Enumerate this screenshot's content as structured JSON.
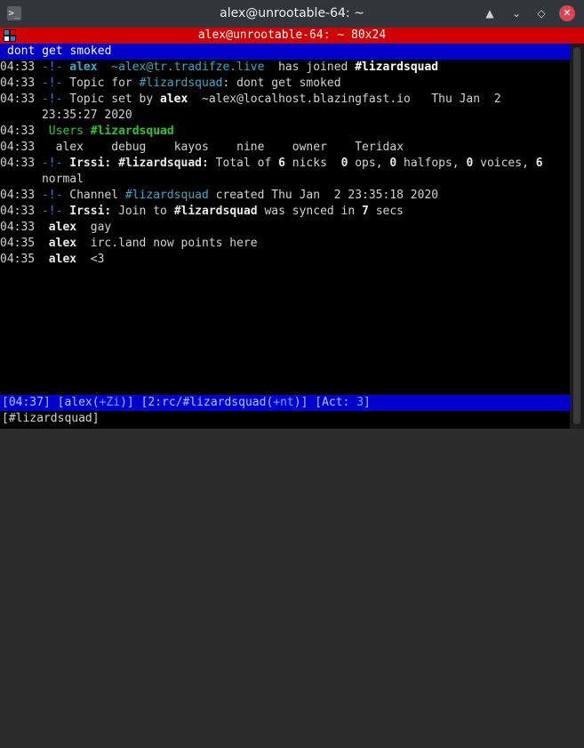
{
  "window": {
    "title": "alex@unrootable-64: ~",
    "tab_title": "alex@unrootable-64: ~ 80x24",
    "controls": {
      "shade": "▲",
      "minimize": "⌄",
      "maximize": "◇",
      "close": "✕"
    }
  },
  "topic_bar": "dont get smoked",
  "lines": [
    {
      "time": "04:33",
      "arrow": "-!-",
      "nick": "alex",
      "host": "~alex@tr.tradifze.live",
      "text": "has joined",
      "channel": "#lizardsquad"
    },
    {
      "time": "04:33",
      "arrow": "-!-",
      "pre": "Topic for",
      "channel": "#lizardsquad",
      "text": ": dont get smoked"
    },
    {
      "time": "04:33",
      "arrow": "-!-",
      "pre": "Topic set by",
      "nick": "alex",
      "host": "~alex@localhost.blazingfast.io",
      "text": "Thu Jan  2",
      "wrap": "23:35:27 2020"
    },
    {
      "time": "04:33",
      "label": "Users",
      "channel": "#lizardsquad"
    },
    {
      "time": "04:33",
      "users": [
        "alex",
        "debug",
        "kayos",
        "nine",
        "owner",
        "Teridax"
      ]
    },
    {
      "time": "04:33",
      "arrow": "-!-",
      "server": "Irssi:",
      "channel": "#lizardsquad:",
      "parts": [
        "Total of",
        "6",
        "nicks",
        "0",
        "ops,",
        "0",
        "halfops,",
        "0",
        "voices,",
        "6"
      ],
      "wrap": "normal"
    },
    {
      "time": "04:33",
      "arrow": "-!-",
      "pre": "Channel",
      "channel": "#lizardsquad",
      "text": "created Thu Jan  2 23:35:18 2020"
    },
    {
      "time": "04:33",
      "arrow": "-!-",
      "server": "Irssi:",
      "pre": "Join to",
      "channel": "#lizardsquad",
      "text": "was synced in",
      "num": "7",
      "post": "secs"
    },
    {
      "time": "04:33",
      "nick": "alex",
      "text": "gay"
    },
    {
      "time": "04:35",
      "nick": "alex",
      "text": "irc.land now points here"
    },
    {
      "time": "04:35",
      "nick": "alex",
      "text": "<3"
    }
  ],
  "status_bar": {
    "time": "04:37",
    "user": "alex",
    "modes": "+Zi",
    "window": "2:rc/#lizardsquad",
    "chan_modes": "+nt",
    "act_label": "Act:",
    "act_value": "3"
  },
  "prompt": "[#lizardsquad]",
  "colors": {
    "titlebar": "#31363b",
    "tabbar": "#d10000",
    "irc_bar": "#0000cc",
    "channel": "#2fc42f",
    "nick_link": "#3ea7c8",
    "close": "#da4453"
  }
}
